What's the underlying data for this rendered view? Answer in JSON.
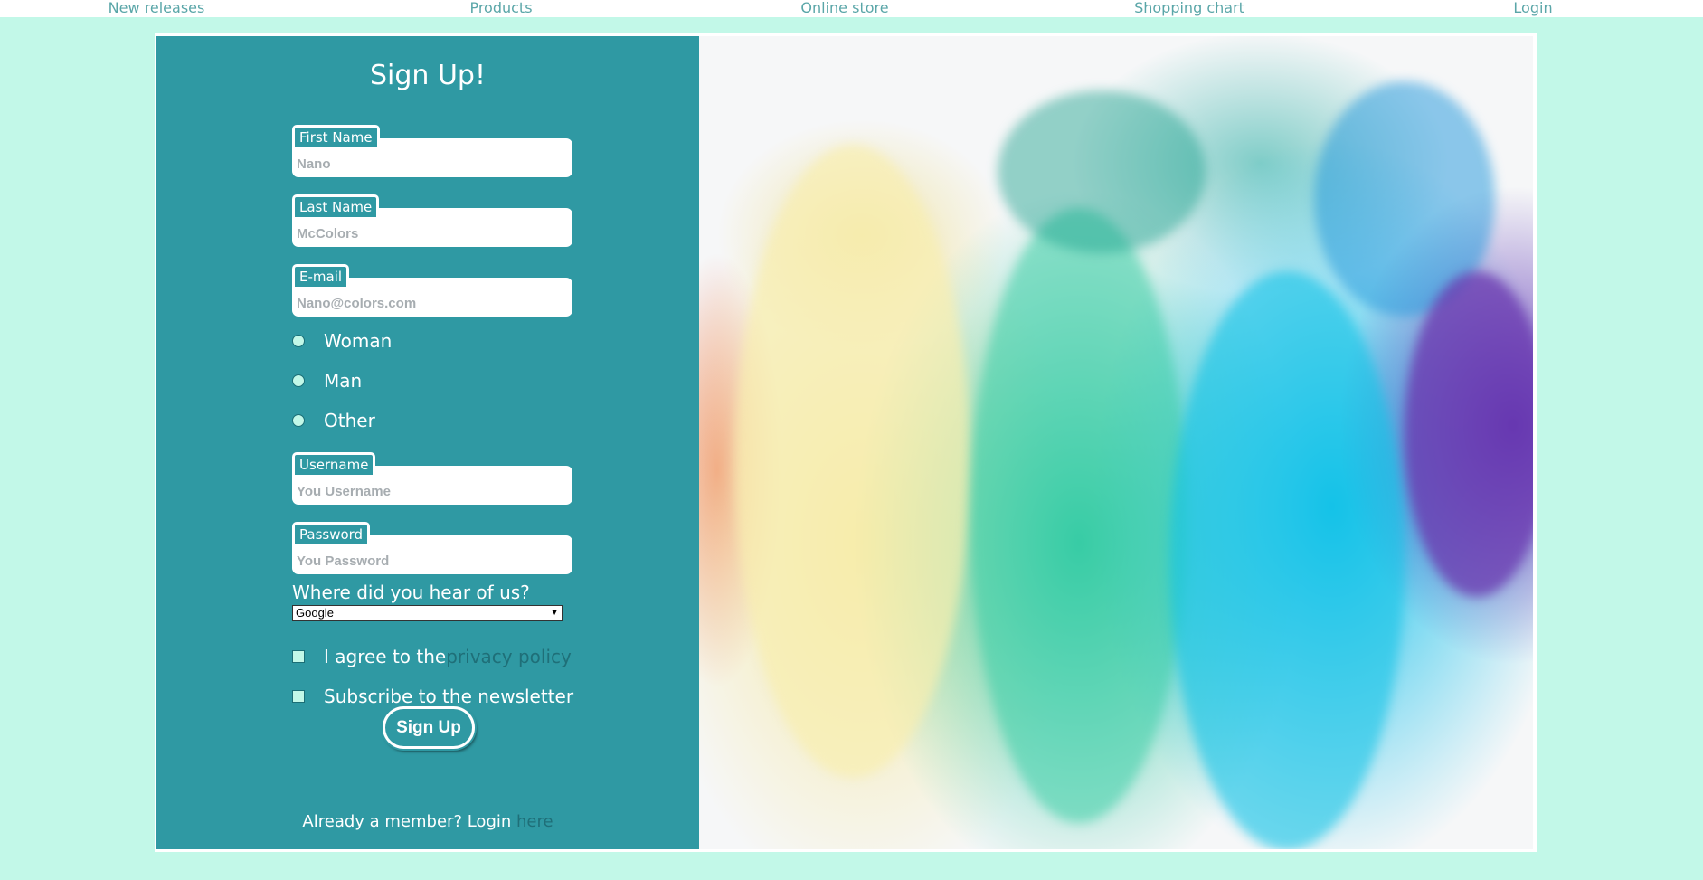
{
  "nav": {
    "items": [
      "New releases",
      "Products",
      "Online store",
      "Shopping chart",
      "Login"
    ]
  },
  "form": {
    "title": "Sign Up!",
    "first_name": {
      "label": "First Name",
      "placeholder": "Nano"
    },
    "last_name": {
      "label": "Last Name",
      "placeholder": "McColors"
    },
    "email": {
      "label": "E-mail",
      "placeholder": "Nano@colors.com"
    },
    "gender_options": [
      "Woman",
      "Man",
      "Other"
    ],
    "username": {
      "label": "Username",
      "placeholder": "You Username"
    },
    "password": {
      "label": "Password",
      "placeholder": "You Password"
    },
    "hear_label": "Where did you hear of us?",
    "hear_selected": "Google",
    "agree_text": "I agree to the",
    "agree_link": "privacy policy",
    "newsletter_text": "Subscribe to the newsletter",
    "submit_label": "Sign Up",
    "member_text": "Already a member? Login",
    "member_link": "here"
  },
  "colors": {
    "background": "#c2f8e8",
    "panel": "#2f99a3",
    "link": "#1f6f78"
  }
}
